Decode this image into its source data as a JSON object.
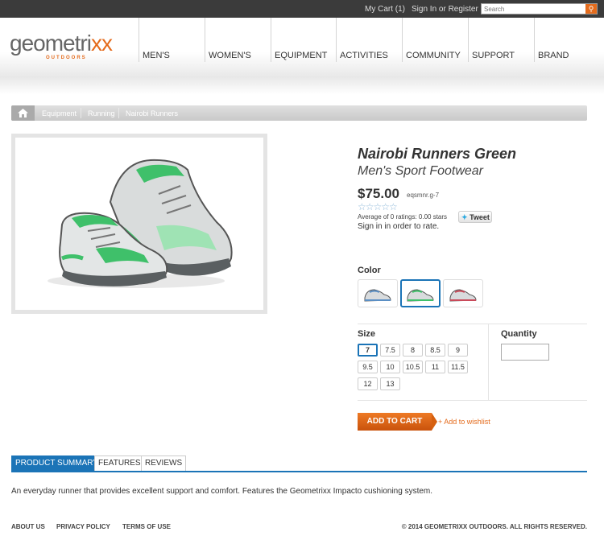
{
  "topbar": {
    "cart": "My Cart (1)",
    "signin": "Sign In or Register",
    "search_placeholder": "Search"
  },
  "logo": {
    "text_main": "geometri",
    "text_accent": "xx",
    "sub": "OUTDOORS"
  },
  "nav": [
    "MEN'S",
    "WOMEN'S",
    "EQUIPMENT",
    "ACTIVITIES",
    "COMMUNITY",
    "SUPPORT",
    "BRAND"
  ],
  "breadcrumb": [
    "Equipment",
    "Running",
    "Nairobi Runners"
  ],
  "product": {
    "title": "Nairobi Runners Green",
    "subtitle": "Men's Sport Footwear",
    "price": "$75.00",
    "sku": "eqsmnr.g-7",
    "stars": "☆☆☆☆☆",
    "rating_text": "Average of 0 ratings: 0.00 stars",
    "signin_text": "Sign in in order to rate.",
    "tweet": "Tweet"
  },
  "color": {
    "label": "Color",
    "swatches": [
      {
        "name": "blue",
        "accent": "#5b8fc4",
        "selected": false
      },
      {
        "name": "green",
        "accent": "#3fc06a",
        "selected": true
      },
      {
        "name": "red",
        "accent": "#c94a5a",
        "selected": false
      }
    ]
  },
  "size": {
    "label": "Size",
    "options": [
      "7",
      "7.5",
      "8",
      "8.5",
      "9",
      "9.5",
      "10",
      "10.5",
      "11",
      "11.5",
      "12",
      "13"
    ],
    "selected": "7"
  },
  "quantity": {
    "label": "Quantity",
    "value": ""
  },
  "actions": {
    "add_to_cart": "ADD TO CART",
    "wishlist": "+ Add to wishlist"
  },
  "tabs": [
    {
      "label": "PRODUCT SUMMARY",
      "active": true
    },
    {
      "label": "FEATURES",
      "active": false
    },
    {
      "label": "REVIEWS",
      "active": false
    }
  ],
  "description": "An everyday runner that provides excellent support and comfort. Features the Geometrixx Impacto cushioning system.",
  "footer": {
    "links": [
      "ABOUT US",
      "PRIVACY POLICY",
      "TERMS OF USE"
    ],
    "copyright": "© 2014 GEOMETRIXX OUTDOORS. ALL RIGHTS RESERVED."
  },
  "colors": {
    "accent": "#e46b1c",
    "selection": "#1b74b7",
    "shoe_accent": "#3fc06a"
  }
}
